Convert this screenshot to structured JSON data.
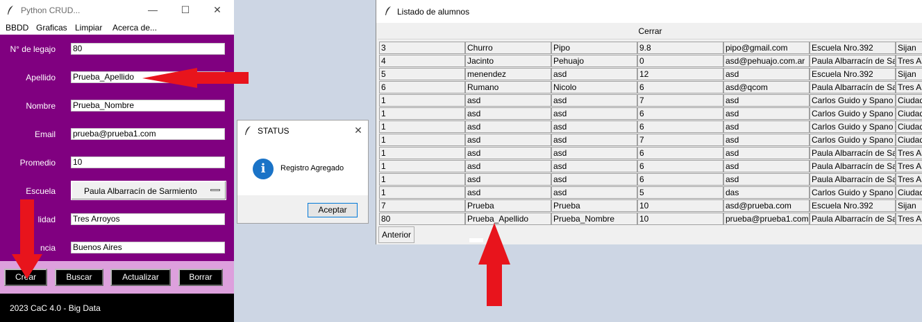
{
  "crud_window": {
    "title": "Python CRUD...",
    "menu": [
      "BBDD",
      "Graficas",
      "Limpiar",
      "Acerca de..."
    ],
    "fields": [
      {
        "label": "N° de legajo",
        "value": "80"
      },
      {
        "label": "Apellido",
        "value": "Prueba_Apellido"
      },
      {
        "label": "Nombre",
        "value": "Prueba_Nombre"
      },
      {
        "label": "Email",
        "value": "prueba@prueba1.com"
      },
      {
        "label": "Promedio",
        "value": "10"
      },
      {
        "label": "Escuela",
        "value": "Paula Albarracín de Sarmiento"
      },
      {
        "label": "lidad",
        "value": "Tres Arroyos"
      },
      {
        "label": "ncia",
        "value": "Buenos Aires"
      }
    ],
    "buttons": [
      "Crear",
      "Buscar",
      "Actualizar",
      "Borrar"
    ],
    "footer": "2023  CaC 4.0 - Big Data"
  },
  "status_dialog": {
    "title": "STATUS",
    "message": "Registro Agregado",
    "ok_label": "Aceptar",
    "icon": "info-icon"
  },
  "listado_window": {
    "title": "Listado de alumnos",
    "close_label": "Cerrar",
    "prev_label": "Anterior",
    "rows": [
      [
        "3",
        "Churro",
        "Pipo",
        "9.8",
        "pipo@gmail.com",
        "Escuela Nro.392",
        "Sijan"
      ],
      [
        "4",
        "Jacinto",
        "Pehuajo",
        "0",
        "asd@pehuajo.com.ar",
        "Paula Albarracín de Sar",
        "Tres Ar"
      ],
      [
        "5",
        "menendez",
        "asd",
        "12",
        "asd",
        "Escuela Nro.392",
        "Sijan"
      ],
      [
        "6",
        "Rumano",
        "Nicolo",
        "6",
        "asd@qcom",
        "Paula Albarracín de Sar",
        "Tres Ar"
      ],
      [
        "1",
        "asd",
        "asd",
        "7",
        "asd",
        "Carlos Guido y Spano",
        "Ciudad"
      ],
      [
        "1",
        "asd",
        "asd",
        "6",
        "asd",
        "Carlos Guido y Spano",
        "Ciudad"
      ],
      [
        "1",
        "asd",
        "asd",
        "6",
        "asd",
        "Carlos Guido y Spano",
        "Ciudad"
      ],
      [
        "1",
        "asd",
        "asd",
        "7",
        "asd",
        "Carlos Guido y Spano",
        "Ciudad"
      ],
      [
        "1",
        "asd",
        "asd",
        "6",
        "asd",
        "Paula Albarracín de Sar",
        "Tres Ar"
      ],
      [
        "1",
        "asd",
        "asd",
        "6",
        "asd",
        "Paula Albarracín de Sar",
        "Tres Ar"
      ],
      [
        "1",
        "asd",
        "asd",
        "6",
        "asd",
        "Paula Albarracín de Sar",
        "Tres Ar"
      ],
      [
        "1",
        "asd",
        "asd",
        "5",
        "das",
        "Carlos Guido y Spano",
        "Ciudad"
      ],
      [
        "7",
        "Prueba",
        "Prueba",
        "10",
        "asd@prueba.com",
        "Escuela Nro.392",
        "Sijan"
      ],
      [
        "80",
        "Prueba_Apellido",
        "Prueba_Nombre",
        "10",
        "prueba@prueba1.com",
        "Paula Albarracín de Sar",
        "Tres Ar"
      ]
    ]
  },
  "colors": {
    "form_bg": "#800080",
    "button_bar_bg": "#dda0dd",
    "footer_bg": "#000000",
    "annotation_arrow": "#e8141c"
  }
}
